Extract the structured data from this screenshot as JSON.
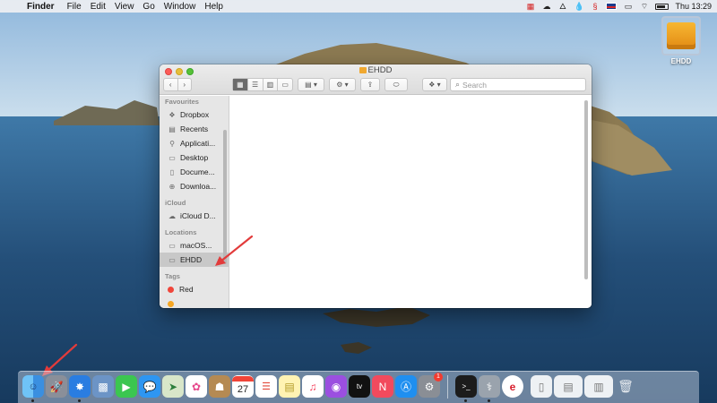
{
  "menubar": {
    "app_name": "Finder",
    "items": [
      "File",
      "Edit",
      "View",
      "Go",
      "Window",
      "Help"
    ],
    "clock": "Thu 13:29"
  },
  "desktop": {
    "disk_label": "EHDD"
  },
  "finder": {
    "title": "EHDD",
    "search_placeholder": "Search",
    "sidebar": {
      "favourites_header": "Favourites",
      "favourites": [
        "Dropbox",
        "Recents",
        "Applicati...",
        "Desktop",
        "Docume...",
        "Downloa..."
      ],
      "icloud_header": "iCloud",
      "icloud": [
        "iCloud D..."
      ],
      "locations_header": "Locations",
      "locations": [
        "macOS...",
        "EHDD"
      ],
      "tags_header": "Tags",
      "tags": [
        "Red"
      ]
    }
  },
  "dock": {
    "calendar_day": "27",
    "badge_count": "1"
  },
  "colors": {
    "annotation_arrow": "#e23b3b",
    "sea": "#2e5e8e",
    "tag_red": "#f0453a"
  }
}
